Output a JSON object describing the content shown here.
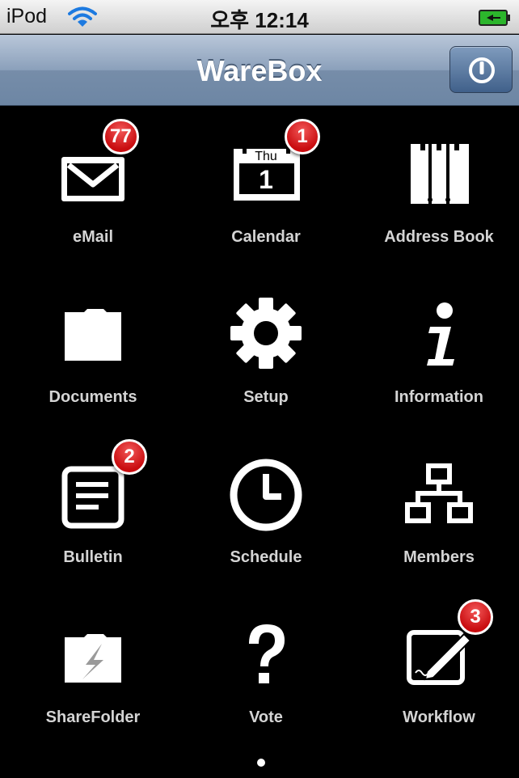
{
  "status_bar": {
    "carrier": "iPod",
    "time": "오후 12:14"
  },
  "nav": {
    "title": "WareBox",
    "power_icon": "power-icon"
  },
  "apps": [
    {
      "label": "eMail",
      "icon": "mail-icon",
      "badge": "77"
    },
    {
      "label": "Calendar",
      "icon": "calendar-icon",
      "badge": "1",
      "calendar_day": "Thu",
      "calendar_date": "1"
    },
    {
      "label": "Address Book",
      "icon": "address-book-icon",
      "badge": ""
    },
    {
      "label": "Documents",
      "icon": "folder-icon",
      "badge": ""
    },
    {
      "label": "Setup",
      "icon": "gear-icon",
      "badge": ""
    },
    {
      "label": "Information",
      "icon": "info-icon",
      "badge": ""
    },
    {
      "label": "Bulletin",
      "icon": "bulletin-icon",
      "badge": "2"
    },
    {
      "label": "Schedule",
      "icon": "clock-icon",
      "badge": ""
    },
    {
      "label": "Members",
      "icon": "org-chart-icon",
      "badge": ""
    },
    {
      "label": "ShareFolder",
      "icon": "share-folder-icon",
      "badge": ""
    },
    {
      "label": "Vote",
      "icon": "question-icon",
      "badge": ""
    },
    {
      "label": "Workflow",
      "icon": "edit-icon",
      "badge": "3"
    }
  ],
  "colors": {
    "badge": "#d9161a",
    "nav_bar": "#7f97b6",
    "background": "#000000"
  },
  "pagination": {
    "current_page": 1,
    "total_pages": 1
  }
}
